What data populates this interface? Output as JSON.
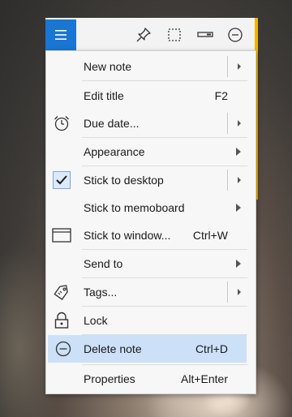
{
  "note": {
    "menu_button_icon": "hamburger-icon",
    "toolbar_icons": [
      "pin-icon",
      "select-region-icon",
      "minimize-bar-icon",
      "minus-circle-icon"
    ]
  },
  "menu": {
    "items": [
      {
        "label": "New note",
        "shortcut": "",
        "icon": "",
        "submenu": true
      },
      {
        "label": "Edit title",
        "shortcut": "F2",
        "icon": "",
        "submenu": false
      },
      {
        "label": "Due date...",
        "shortcut": "",
        "icon": "alarm-clock-icon",
        "submenu": true
      },
      {
        "label": "Appearance",
        "shortcut": "",
        "icon": "",
        "submenu": true
      },
      {
        "label": "Stick to desktop",
        "shortcut": "",
        "icon": "checkmark-icon",
        "submenu": true
      },
      {
        "label": "Stick to memoboard",
        "shortcut": "",
        "icon": "",
        "submenu": true
      },
      {
        "label": "Stick to window...",
        "shortcut": "Ctrl+W",
        "icon": "window-icon",
        "submenu": false
      },
      {
        "label": "Send to",
        "shortcut": "",
        "icon": "",
        "submenu": true
      },
      {
        "label": "Tags...",
        "shortcut": "",
        "icon": "tag-icon",
        "submenu": true
      },
      {
        "label": "Lock",
        "shortcut": "",
        "icon": "lock-icon",
        "submenu": false
      },
      {
        "label": "Delete note",
        "shortcut": "Ctrl+D",
        "icon": "minus-circle-icon",
        "submenu": false
      },
      {
        "label": "Properties",
        "shortcut": "Alt+Enter",
        "icon": "",
        "submenu": false
      }
    ]
  },
  "colors": {
    "note_yellow": "#ffd34d",
    "accent_blue": "#1976d2",
    "highlight": "#cce0f7"
  }
}
